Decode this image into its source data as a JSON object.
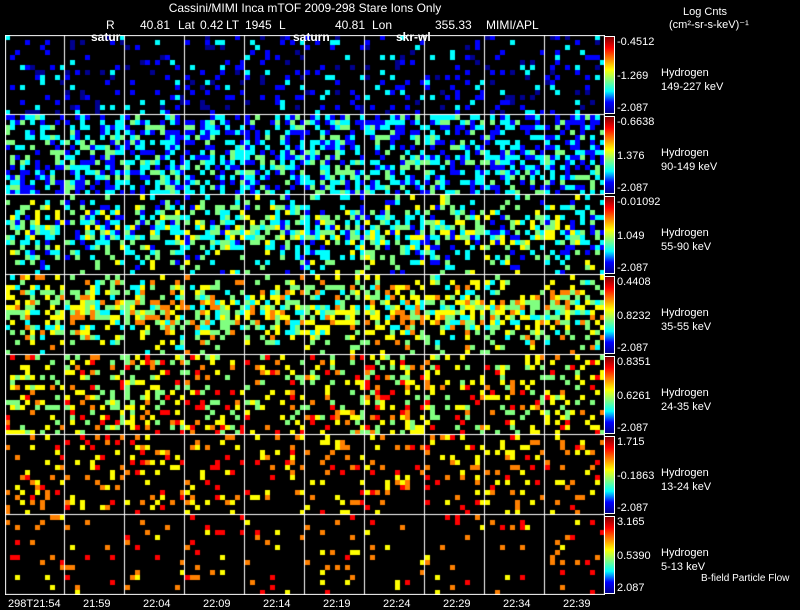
{
  "header": {
    "title": "Cassini/MIMI Inca mTOF  2009-298   Stare   Ions Only",
    "r_label": "R",
    "r_value": "40.81",
    "lat_label": "Lat",
    "lat_value": "0.42",
    "lt_label": "LT",
    "lt_value": "1945",
    "l_label": "L",
    "l_value": "40.81",
    "lon_label": "Lon",
    "lon_value": "355.33",
    "credit": "MIMI/APL",
    "overlays": [
      "satur",
      "saturn",
      "skr-wl"
    ]
  },
  "colorbar_title": "Log Cnts",
  "colorbar_units": "(cm²-sr-s-keV)⁻¹",
  "footer_note": "B-field Particle Flow",
  "chart_data": {
    "type": "heatmap",
    "colormap": [
      "#00008f",
      "#0000ff",
      "#00ffff",
      "#80ff80",
      "#ffff00",
      "#ff8000",
      "#ff0000",
      "#800000"
    ],
    "time_labels": [
      "298T21:54",
      "21:59",
      "22:04",
      "22:09",
      "22:14",
      "22:19",
      "22:24",
      "22:29",
      "22:34",
      "22:39"
    ],
    "rows": [
      {
        "species": "Hydrogen",
        "energy": "149-227 keV",
        "max": "-0.4512",
        "mid": "-1.269",
        "min": "-2.087"
      },
      {
        "species": "Hydrogen",
        "energy": "90-149 keV",
        "max": "-0.6638",
        "mid": "1.376",
        "min": "-2.087"
      },
      {
        "species": "Hydrogen",
        "energy": "55-90 keV",
        "max": "-0.01092",
        "mid": "1.049",
        "min": "-2.087"
      },
      {
        "species": "Hydrogen",
        "energy": "35-55 keV",
        "max": "0.4408",
        "mid": "0.8232",
        "min": "-2.087"
      },
      {
        "species": "Hydrogen",
        "energy": "24-35 keV",
        "max": "0.8351",
        "mid": "0.6261",
        "min": "-2.087"
      },
      {
        "species": "Hydrogen",
        "energy": "13-24 keV",
        "max": "1.715",
        "mid": "-0.1863",
        "min": "-2.087"
      },
      {
        "species": "Hydrogen",
        "energy": "5-13 keV",
        "max": "3.165",
        "mid": "0.5390",
        "min": "2.087"
      }
    ]
  }
}
